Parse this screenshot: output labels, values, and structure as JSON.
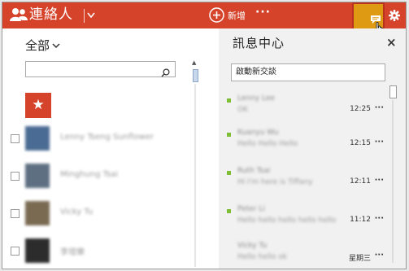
{
  "app": {
    "title": "連絡人"
  },
  "toolbar": {
    "new_label": "新增",
    "more": "···"
  },
  "left": {
    "filter_label": "全部",
    "search_placeholder": "",
    "favorites_icon": "star",
    "contacts": [
      {
        "name": "Lenny Tseng Sunflower",
        "avatar_color": "#4a6b93"
      },
      {
        "name": "Minghung Tsai",
        "avatar_color": "#5f6f82"
      },
      {
        "name": "Vicky Tu",
        "avatar_color": "#7a6a52"
      },
      {
        "name": "李增樂",
        "avatar_color": "#2c2c2c"
      }
    ]
  },
  "messaging": {
    "title": "訊息中心",
    "close": "×",
    "new_conversation": "啟動新交談",
    "conversations": [
      {
        "name": "Lenny Lee",
        "preview": "OK",
        "time": "12:25",
        "unread": true
      },
      {
        "name": "Kuanyu Wu",
        "preview": "Hello Hello Hello",
        "time": "12:15",
        "unread": true
      },
      {
        "name": "Ruth Tsai",
        "preview": "Hi I'm here is Tiffany",
        "time": "12:11",
        "unread": true
      },
      {
        "name": "Peter Li",
        "preview": "Hello hello hello hello hello",
        "time": "11:12",
        "unread": true
      },
      {
        "name": "Vicky Tu",
        "preview": "Hello hello ok",
        "time": "星期三",
        "unread": false
      }
    ]
  },
  "colors": {
    "brand": "#d6432b",
    "chat_highlight": "#dd9a12",
    "unread": "#7dbe34"
  }
}
